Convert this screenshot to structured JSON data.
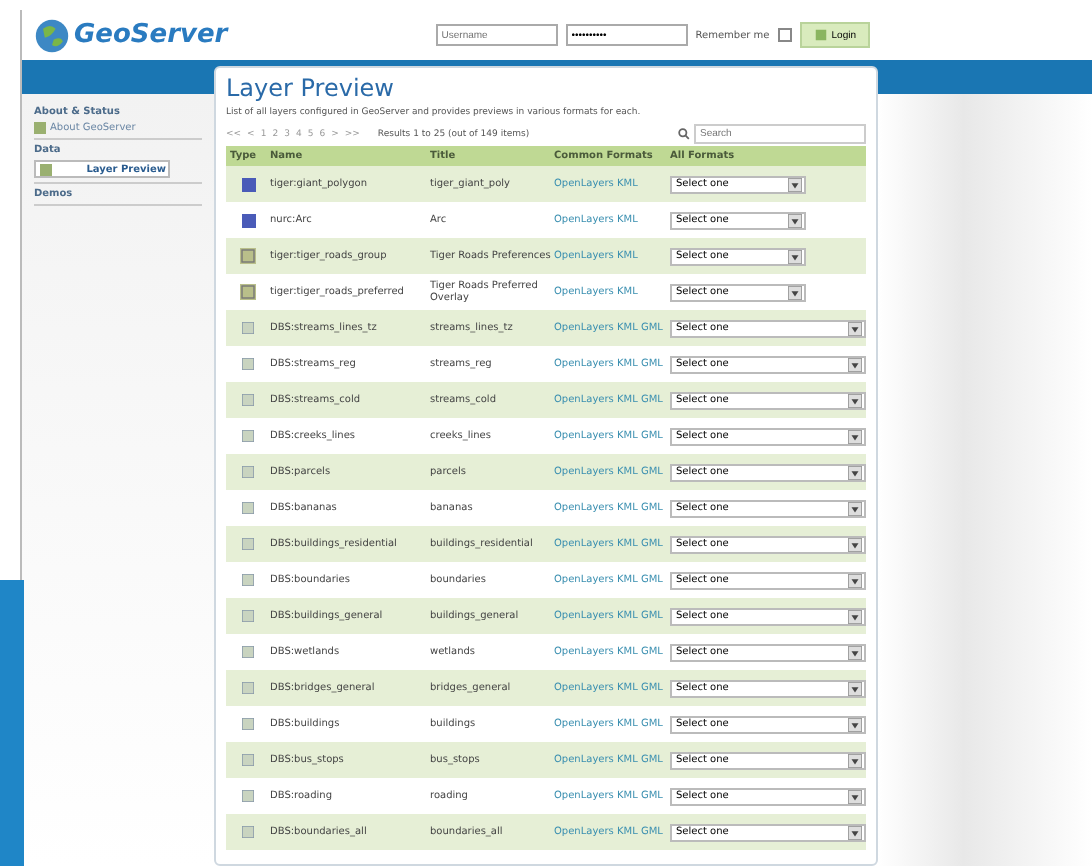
{
  "header": {
    "logo": "GeoServer",
    "username": {
      "placeholder": "Username"
    },
    "password": {
      "value": "••••••••••"
    },
    "remember": {
      "label": "Remember me",
      "checked": false
    },
    "login": "Login"
  },
  "sidebar": {
    "sections": [
      {
        "title": "About & Status",
        "items": [
          {
            "label": "About GeoServer",
            "selected": false
          }
        ]
      },
      {
        "title": "Data",
        "items": [
          {
            "label": "Layer Preview",
            "selected": true
          }
        ]
      },
      {
        "title": "Demos"
      }
    ]
  },
  "page": {
    "title": "Layer Preview",
    "description": "List of all layers configured in GeoServer and provides previews in various formats for each.",
    "pager": [
      "<<",
      "<",
      "1",
      "2",
      "3",
      "4",
      "5",
      "6",
      ">",
      ">>"
    ],
    "results": "Results 1 to 25 (out of 149 items)",
    "search": {
      "placeholder": "Search"
    },
    "columns": [
      "Type",
      "Name",
      "Title",
      "Common Formats",
      "All Formats"
    ],
    "rows": [
      {
        "kind": "raster",
        "name": "tiger:giant_polygon",
        "title": "tiger_giant_poly",
        "formats": "OpenLayers KML",
        "select": "Select one",
        "wide": false
      },
      {
        "kind": "raster",
        "name": "nurc:Arc",
        "title": "Arc",
        "formats": "OpenLayers KML",
        "select": "Select one",
        "wide": false
      },
      {
        "kind": "group",
        "name": "tiger:tiger_roads_group",
        "title": "Tiger Roads Preferences",
        "formats": "OpenLayers KML",
        "select": "Select one",
        "wide": false
      },
      {
        "kind": "group",
        "name": "tiger:tiger_roads_preferred",
        "title": "Tiger Roads Preferred Overlay",
        "formats": "OpenLayers KML",
        "select": "Select one",
        "wide": false
      },
      {
        "kind": "vector",
        "name": "DBS:streams_lines_tz",
        "title": "streams_lines_tz",
        "formats": "OpenLayers KML GML",
        "select": "Select one",
        "wide": true
      },
      {
        "kind": "vector",
        "name": "DBS:streams_reg",
        "title": "streams_reg",
        "formats": "OpenLayers KML GML",
        "select": "Select one",
        "wide": true
      },
      {
        "kind": "vector",
        "name": "DBS:streams_cold",
        "title": "streams_cold",
        "formats": "OpenLayers KML GML",
        "select": "Select one",
        "wide": true
      },
      {
        "kind": "vector",
        "name": "DBS:creeks_lines",
        "title": "creeks_lines",
        "formats": "OpenLayers KML GML",
        "select": "Select one",
        "wide": true
      },
      {
        "kind": "vector",
        "name": "DBS:parcels",
        "title": "parcels",
        "formats": "OpenLayers KML GML",
        "select": "Select one",
        "wide": true
      },
      {
        "kind": "vector",
        "name": "DBS:bananas",
        "title": "bananas",
        "formats": "OpenLayers KML GML",
        "select": "Select one",
        "wide": true
      },
      {
        "kind": "vector",
        "name": "DBS:buildings_residential",
        "title": "buildings_residential",
        "formats": "OpenLayers KML GML",
        "select": "Select one",
        "wide": true
      },
      {
        "kind": "vector",
        "name": "DBS:boundaries",
        "title": "boundaries",
        "formats": "OpenLayers KML GML",
        "select": "Select one",
        "wide": true
      },
      {
        "kind": "vector",
        "name": "DBS:buildings_general",
        "title": "buildings_general",
        "formats": "OpenLayers KML GML",
        "select": "Select one",
        "wide": true
      },
      {
        "kind": "vector",
        "name": "DBS:wetlands",
        "title": "wetlands",
        "formats": "OpenLayers KML GML",
        "select": "Select one",
        "wide": true
      },
      {
        "kind": "vector",
        "name": "DBS:bridges_general",
        "title": "bridges_general",
        "formats": "OpenLayers KML GML",
        "select": "Select one",
        "wide": true
      },
      {
        "kind": "vector",
        "name": "DBS:buildings",
        "title": "buildings",
        "formats": "OpenLayers KML GML",
        "select": "Select one",
        "wide": true
      },
      {
        "kind": "vector",
        "name": "DBS:bus_stops",
        "title": "bus_stops",
        "formats": "OpenLayers KML GML",
        "select": "Select one",
        "wide": true
      },
      {
        "kind": "vector",
        "name": "DBS:roading",
        "title": "roading",
        "formats": "OpenLayers KML GML",
        "select": "Select one",
        "wide": true
      },
      {
        "kind": "vector",
        "name": "DBS:boundaries_all",
        "title": "boundaries_all",
        "formats": "OpenLayers KML GML",
        "select": "Select one",
        "wide": true
      }
    ]
  }
}
